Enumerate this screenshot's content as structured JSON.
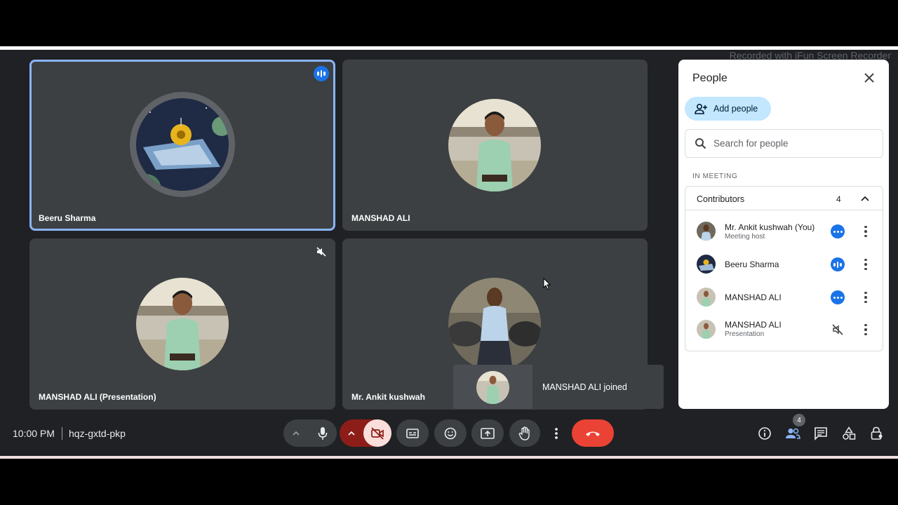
{
  "watermark": "Recorded with iFun Screen Recorder",
  "tiles": [
    {
      "name": "Beeru Sharma",
      "status": "speaking"
    },
    {
      "name": "MANSHAD ALI",
      "status": ""
    },
    {
      "name": "MANSHAD ALI (Presentation)",
      "status": "muted"
    },
    {
      "name": "Mr. Ankit kushwah",
      "status": ""
    }
  ],
  "toast": {
    "text": "MANSHAD ALI joined"
  },
  "people_panel": {
    "title": "People",
    "add_people_label": "Add people",
    "search_placeholder": "Search for people",
    "section_label": "IN MEETING",
    "contributors_label": "Contributors",
    "contributors_count": "4",
    "people": [
      {
        "name": "Mr. Ankit kushwah (You)",
        "subtitle": "Meeting host",
        "status": "dots"
      },
      {
        "name": "Beeru Sharma",
        "subtitle": "",
        "status": "speaking"
      },
      {
        "name": "MANSHAD ALI",
        "subtitle": "",
        "status": "dots"
      },
      {
        "name": "MANSHAD ALI",
        "subtitle": "Presentation",
        "status": "muted"
      }
    ]
  },
  "bottom_bar": {
    "time": "10:00 PM",
    "meeting_code": "hqz-gxtd-pkp",
    "people_badge": "4"
  },
  "colors": {
    "stage_bg": "#202124",
    "tile_bg": "#3c4043",
    "active_outline": "#8ab4f8",
    "accent_blue": "#1a73e8",
    "end_call_red": "#ea4335",
    "camera_off_bg": "#f9dedc",
    "camera_off_dark": "#8c1d18",
    "add_people_bg": "#c2e7ff"
  },
  "icons": {
    "tile_speaking": "audio-bars-icon",
    "tile_muted": "mic-off-icon",
    "close": "close-icon",
    "add_people": "person-add-icon",
    "search": "search-icon",
    "collapse": "chevron-up-icon",
    "more": "more-vert-icon",
    "mic": "mic-icon",
    "camera": "videocam-off-icon",
    "captions": "closed-caption-icon",
    "reactions": "emoji-icon",
    "present": "present-screen-icon",
    "hand": "raise-hand-icon",
    "end_call": "call-end-icon",
    "info": "info-icon",
    "people": "people-icon",
    "chat": "chat-icon",
    "activities": "activities-icon",
    "host_controls": "lock-person-icon"
  }
}
